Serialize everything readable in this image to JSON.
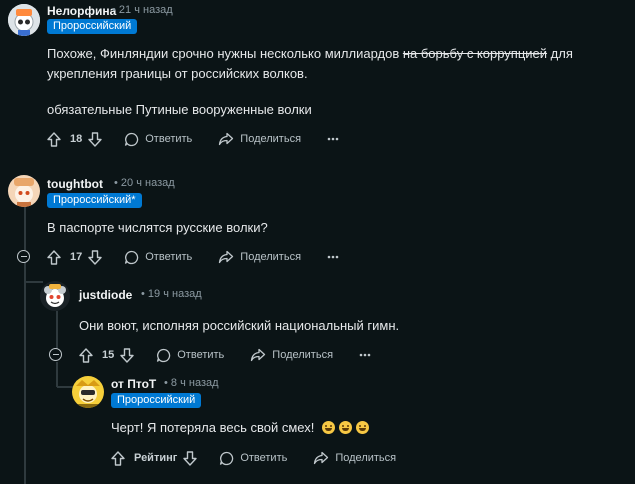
{
  "comments": [
    {
      "username": "Нелорфина",
      "time": "21 ч назад",
      "flair": "Пророссийский",
      "body": {
        "pre": "Похоже, Финляндии срочно нужны несколько миллиардов ",
        "strike": "на борьбу с коррупцией",
        "post": " для укрепления границы от российских волков.",
        "line2": "обязательные Путиные вооруженные волки"
      },
      "votes": "18",
      "reply_label": "Ответить",
      "share_label": "Поделиться"
    },
    {
      "username": "toughtbot",
      "time": "20 ч назад",
      "flair": "Пророссийский*",
      "body": "В паспорте числятся русские волки?",
      "votes": "17",
      "reply_label": "Ответить",
      "share_label": "Поделиться"
    },
    {
      "username": "justdiode",
      "time": "19 ч назад",
      "body": "Они воют, исполняя российский национальный гимн.",
      "votes": "15",
      "reply_label": "Ответить",
      "share_label": "Поделиться"
    },
    {
      "username": "от ПтоТ",
      "time": "8 ч назад",
      "flair": "Пророссийский",
      "body": "Черт! Я потеряла весь свой смех!",
      "votes": "Рейтинг",
      "reply_label": "Ответить",
      "share_label": "Поделиться"
    }
  ],
  "icons": {
    "upvote": "upvote-arrow-icon",
    "downvote": "downvote-arrow-icon",
    "reply": "speech-bubble-icon",
    "share": "share-arrow-icon",
    "more": "ellipsis-icon",
    "collapse": "collapse-minus-icon",
    "emoji": "grinning-face-icon"
  },
  "colors": {
    "background": "#0b1416",
    "flair": "#0079d3",
    "thread_line": "#2f3a3e"
  }
}
